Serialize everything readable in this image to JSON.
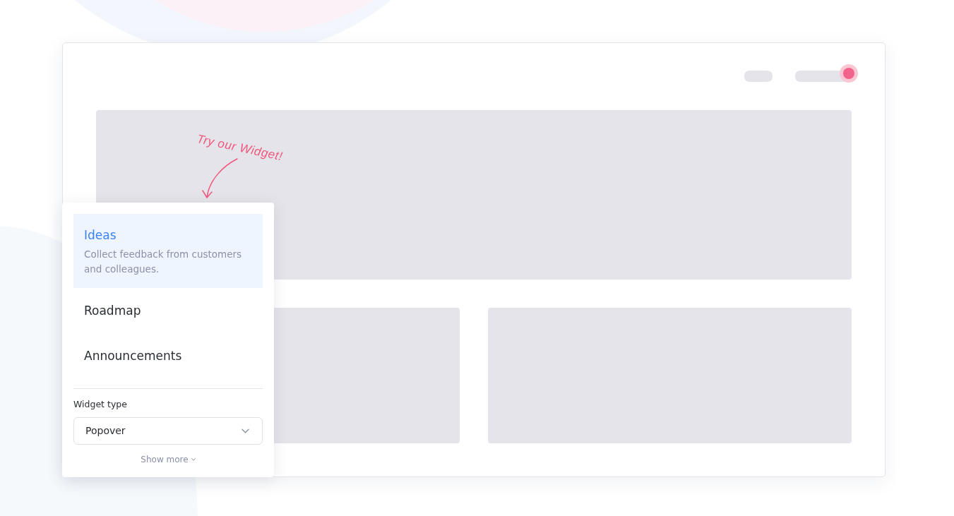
{
  "header": {
    "notification_dot": true
  },
  "annotation": {
    "text": "Try our Widget!"
  },
  "widget_menu": {
    "items": [
      {
        "title": "Ideas",
        "description": "Collect feedback from customers and colleagues.",
        "selected": true
      },
      {
        "title": "Roadmap",
        "selected": false
      },
      {
        "title": "Announcements",
        "selected": false
      }
    ],
    "widget_type": {
      "label": "Widget type",
      "value": "Popover"
    },
    "show_more": "Show more"
  }
}
